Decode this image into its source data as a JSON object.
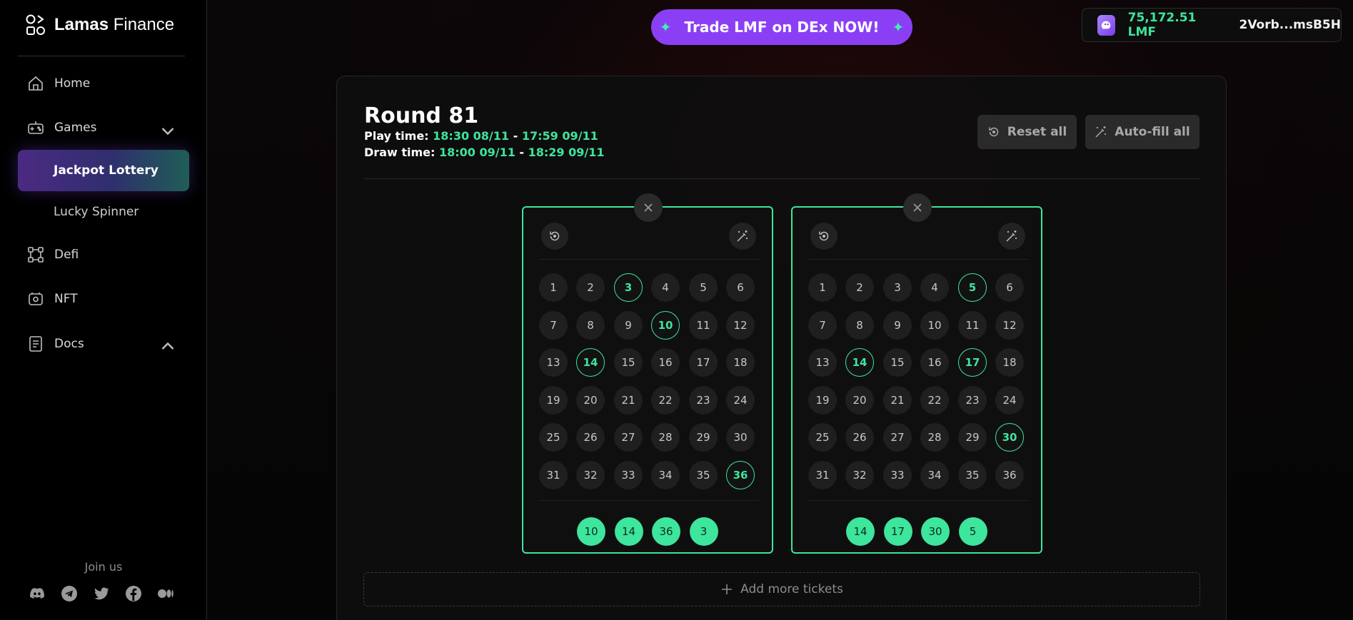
{
  "brand": {
    "bold": "Lamas",
    "regular": "Finance"
  },
  "nav": {
    "home": "Home",
    "games": "Games",
    "games_sub": [
      "Jackpot Lottery",
      "Lucky Spinner"
    ],
    "defi": "Defi",
    "nft": "NFT",
    "docs": "Docs"
  },
  "social": {
    "join_label": "Join us",
    "icons": [
      "discord-icon",
      "telegram-icon",
      "twitter-icon",
      "facebook-icon",
      "medium-icon"
    ]
  },
  "header": {
    "trade_label": "Trade LMF on DEx NOW!",
    "spark": "✦",
    "wallet_balance": "75,172.51 LMF",
    "wallet_address": "2Vorb...msB5H"
  },
  "round": {
    "title": "Round 81",
    "play_label": "Play time:",
    "play_start": "18:30 08/11",
    "play_end": "17:59 09/11",
    "draw_label": "Draw time:",
    "draw_start": "18:00 09/11",
    "draw_end": "18:29 09/11",
    "sep": "-",
    "reset_all": "Reset all",
    "auto_fill_all": "Auto-fill all"
  },
  "tickets": [
    {
      "selected": [
        3,
        10,
        14,
        36
      ],
      "picks": [
        10,
        14,
        36,
        3
      ]
    },
    {
      "selected": [
        5,
        14,
        17,
        30
      ],
      "picks": [
        14,
        17,
        30,
        5
      ]
    }
  ],
  "add_more_label": "Add more tickets",
  "colors": {
    "accent_green": "#3ee59c",
    "accent_purple": "#8b3ff5"
  }
}
